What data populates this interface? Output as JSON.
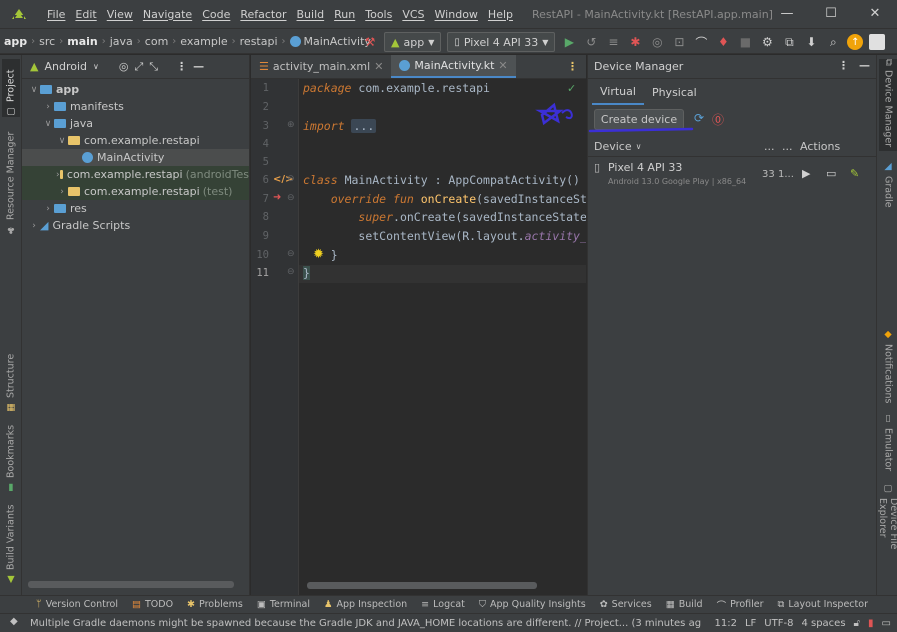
{
  "menubar": {
    "items": [
      "File",
      "Edit",
      "View",
      "Navigate",
      "Code",
      "Refactor",
      "Build",
      "Run",
      "Tools",
      "VCS",
      "Window",
      "Help"
    ],
    "title": "RestAPI - MainActivity.kt [RestAPI.app.main]",
    "win_minimize": "—",
    "win_maximize": "☐",
    "win_close": "✕"
  },
  "navbar": {
    "breadcrumbs": [
      "app",
      "src",
      "main",
      "java",
      "com",
      "example",
      "restapi",
      "MainActivity"
    ],
    "run_config": "app",
    "device": "Pixel 4 API 33"
  },
  "left_stripe": {
    "project": "Project",
    "resource_manager": "Resource Manager",
    "structure": "Structure",
    "bookmarks": "Bookmarks",
    "build_variants": "Build Variants"
  },
  "project_panel": {
    "view_mode": "Android",
    "tree": [
      {
        "label": "app",
        "depth": 0
      },
      {
        "label": "manifests",
        "depth": 1
      },
      {
        "label": "java",
        "depth": 1
      },
      {
        "label": "com.example.restapi",
        "depth": 2
      },
      {
        "label": "MainActivity",
        "depth": 3
      },
      {
        "label": "com.example.restapi",
        "suffix": "(androidTes",
        "depth": 2
      },
      {
        "label": "com.example.restapi",
        "suffix": "(test)",
        "depth": 2
      },
      {
        "label": "res",
        "depth": 1
      },
      {
        "label": "Gradle Scripts",
        "depth": 0
      }
    ]
  },
  "editor": {
    "tabs": [
      {
        "label": "activity_main.xml"
      },
      {
        "label": "MainActivity.kt"
      }
    ],
    "line_numbers": [
      "1",
      "2",
      "3",
      "4",
      "5",
      "6",
      "7",
      "8",
      "9",
      "10",
      "11"
    ],
    "code": {
      "l1_kw": "package",
      "l1_rest": " com.example.restapi",
      "l3_kw": "import",
      "l3_fold": "...",
      "l6_kw": "class",
      "l6_name": "MainActivity",
      "l6_rest": " : AppCompatActivity() {",
      "l7_kw": "override fun",
      "l7_fn": "onCreate",
      "l7_rest": "(savedInstanceSt",
      "l8_kw": "super",
      "l8_rest": ".onCreate(savedInstanceState",
      "l9_fn": "setContentView",
      "l9_mid": "(R.layout.",
      "l9_prop": "activity_",
      "l10": "}",
      "l11": "}"
    }
  },
  "device_manager": {
    "title": "Device Manager",
    "tabs": [
      "Virtual",
      "Physical"
    ],
    "create_button": "Create device",
    "col_device": "Device",
    "col_dots1": "...",
    "col_dots2": "...",
    "col_actions": "Actions",
    "device_name": "Pixel 4 API 33",
    "device_desc": "Android 13.0 Google Play | x86_64",
    "device_api": "33",
    "device_size": "1..."
  },
  "right_stripe": {
    "device_manager": "Device Manager",
    "gradle": "Gradle",
    "notifications": "Notifications",
    "emulator": "Emulator",
    "device_file_explorer": "Device File Explorer"
  },
  "tool_windows": [
    "Version Control",
    "TODO",
    "Problems",
    "Terminal",
    "App Inspection",
    "Logcat",
    "App Quality Insights",
    "Services",
    "Build",
    "Profiler",
    "Layout Inspector"
  ],
  "status": {
    "message": "Multiple Gradle daemons might be spawned because the Gradle JDK and JAVA_HOME locations are different. // Project... (3 minutes ag",
    "position": "11:2",
    "line_sep": "LF",
    "encoding": "UTF-8",
    "indent": "4 spaces"
  },
  "colors": {
    "android_green": "#a4c639",
    "folder_blue": "#5a9fd4",
    "folder_yellow": "#e8c46a",
    "accent_blue": "#4a88c7",
    "annotation_blue": "#3b2fd6",
    "warning_red": "#e05555"
  }
}
